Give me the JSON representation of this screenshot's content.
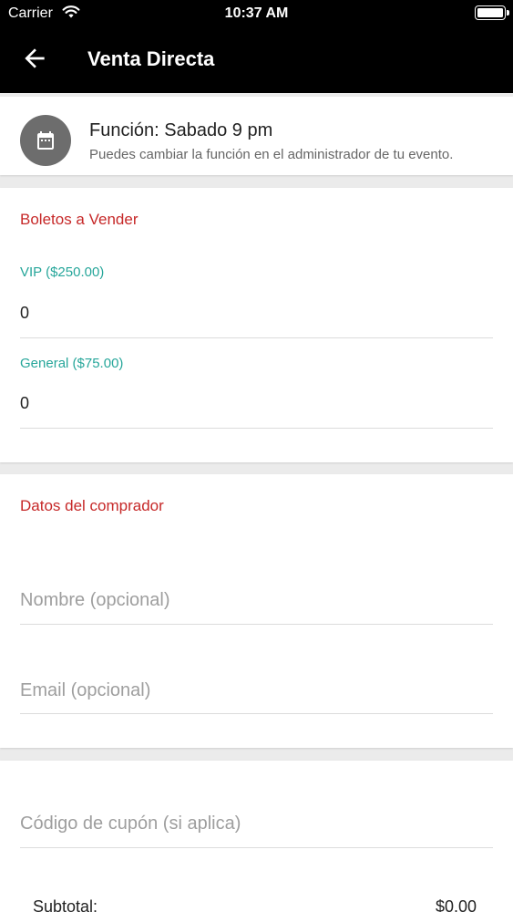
{
  "status_bar": {
    "carrier": "Carrier",
    "time": "10:37 AM"
  },
  "header": {
    "title": "Venta Directa",
    "back_icon": "arrow-left-icon"
  },
  "funcion": {
    "icon": "calendar-icon",
    "title": "Función: Sabado 9 pm",
    "subtitle": "Puedes cambiar la función en el administrador de tu evento."
  },
  "boletos": {
    "section_title": "Boletos a Vender",
    "tickets": [
      {
        "label": "VIP ($250.00)",
        "value": "0"
      },
      {
        "label": "General ($75.00)",
        "value": "0"
      }
    ]
  },
  "comprador": {
    "section_title": "Datos del comprador",
    "nombre_placeholder": "Nombre (opcional)",
    "email_placeholder": "Email (opcional)"
  },
  "cupon": {
    "placeholder": "Código de cupón (si aplica)",
    "subtotal_label": "Subtotal:",
    "subtotal_value": "$0.00"
  },
  "colors": {
    "section_title": "#c62828",
    "field_label": "#26a69a",
    "header_bg": "#000000"
  }
}
